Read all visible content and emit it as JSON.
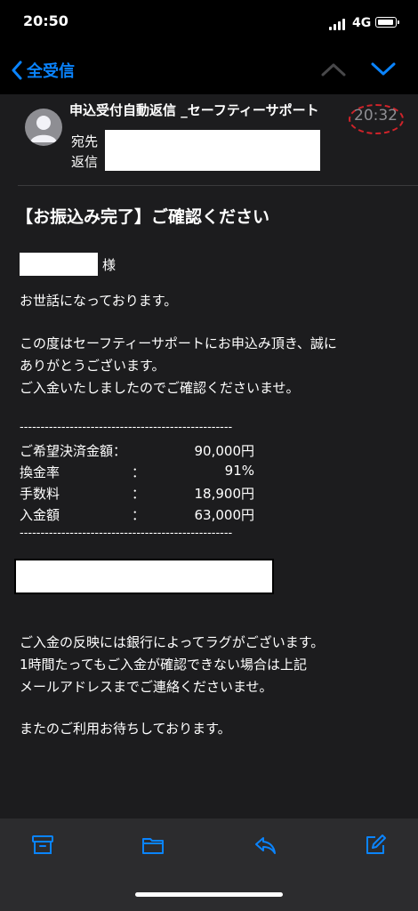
{
  "status_bar": {
    "time": "20:50",
    "network": "4G"
  },
  "nav": {
    "back_label": "全受信"
  },
  "email": {
    "sender": "申込受付自動返信 _セーフティーサポート",
    "time": "20:32",
    "to_label": "宛先",
    "reply_label": "返信",
    "subject": "【お振込み完了】ご確認ください",
    "salutation_suffix": "様",
    "line1": "お世話になっております。",
    "line2a": "この度はセーフティーサポートにお申込み頂き、誠に",
    "line2b": "ありがとうございます。",
    "line3": "ご入金いたしましたのでご確認くださいませ。",
    "dashes": "---------------------------------------------------",
    "rows": [
      {
        "label": "ご希望決済金額：",
        "colon": "",
        "value": "90,000円"
      },
      {
        "label": "換金率",
        "colon": "：",
        "value": "91%"
      },
      {
        "label": "手数料",
        "colon": "：",
        "value": "18,900円"
      },
      {
        "label": "入金額",
        "colon": "：",
        "value": "63,000円"
      }
    ],
    "note1": "ご入金の反映には銀行によってラグがございます。",
    "note2": "1時間たってもご入金が確認できない場合は上記",
    "note3": "メールアドレスまでご連絡くださいませ。",
    "closing": "またのご利用お待ちしております。"
  },
  "colors": {
    "accent": "#0a84ff",
    "background": "#1c1c1e",
    "stamp": "#d0232a"
  },
  "toolbar": {
    "icons": [
      "archive-icon",
      "folder-icon",
      "reply-icon",
      "compose-icon"
    ]
  }
}
